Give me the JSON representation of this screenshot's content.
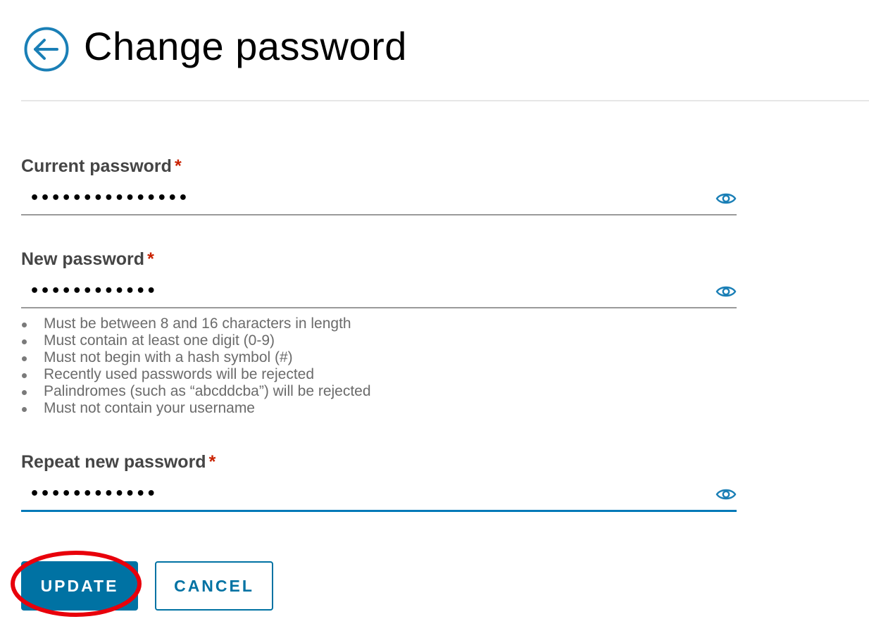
{
  "header": {
    "title": "Change password",
    "back_icon": "arrow-left-circle-icon"
  },
  "form": {
    "current_password": {
      "label": "Current password",
      "required_mark": "*",
      "value": "•••••••••••••••",
      "visibility_icon": "eye-icon"
    },
    "new_password": {
      "label": "New password",
      "required_mark": "*",
      "value": "••••••••••••",
      "visibility_icon": "eye-icon",
      "rules": [
        "Must be between 8 and 16 characters in length",
        "Must contain at least one digit (0-9)",
        "Must not begin with a hash symbol (#)",
        "Recently used passwords will be rejected",
        "Palindromes (such as “abcddcba”) will be rejected",
        "Must not contain your username"
      ]
    },
    "repeat_password": {
      "label": "Repeat new password",
      "required_mark": "*",
      "value": "••••••••••••",
      "visibility_icon": "eye-icon",
      "focused": true
    }
  },
  "actions": {
    "update_label": "UPDATE",
    "cancel_label": "CANCEL"
  },
  "colors": {
    "primary": "#0072a3",
    "focus_underline": "#0079b8",
    "required": "#c92100",
    "annotation_ring": "#e8000b",
    "icon": "#1a7fb6"
  }
}
